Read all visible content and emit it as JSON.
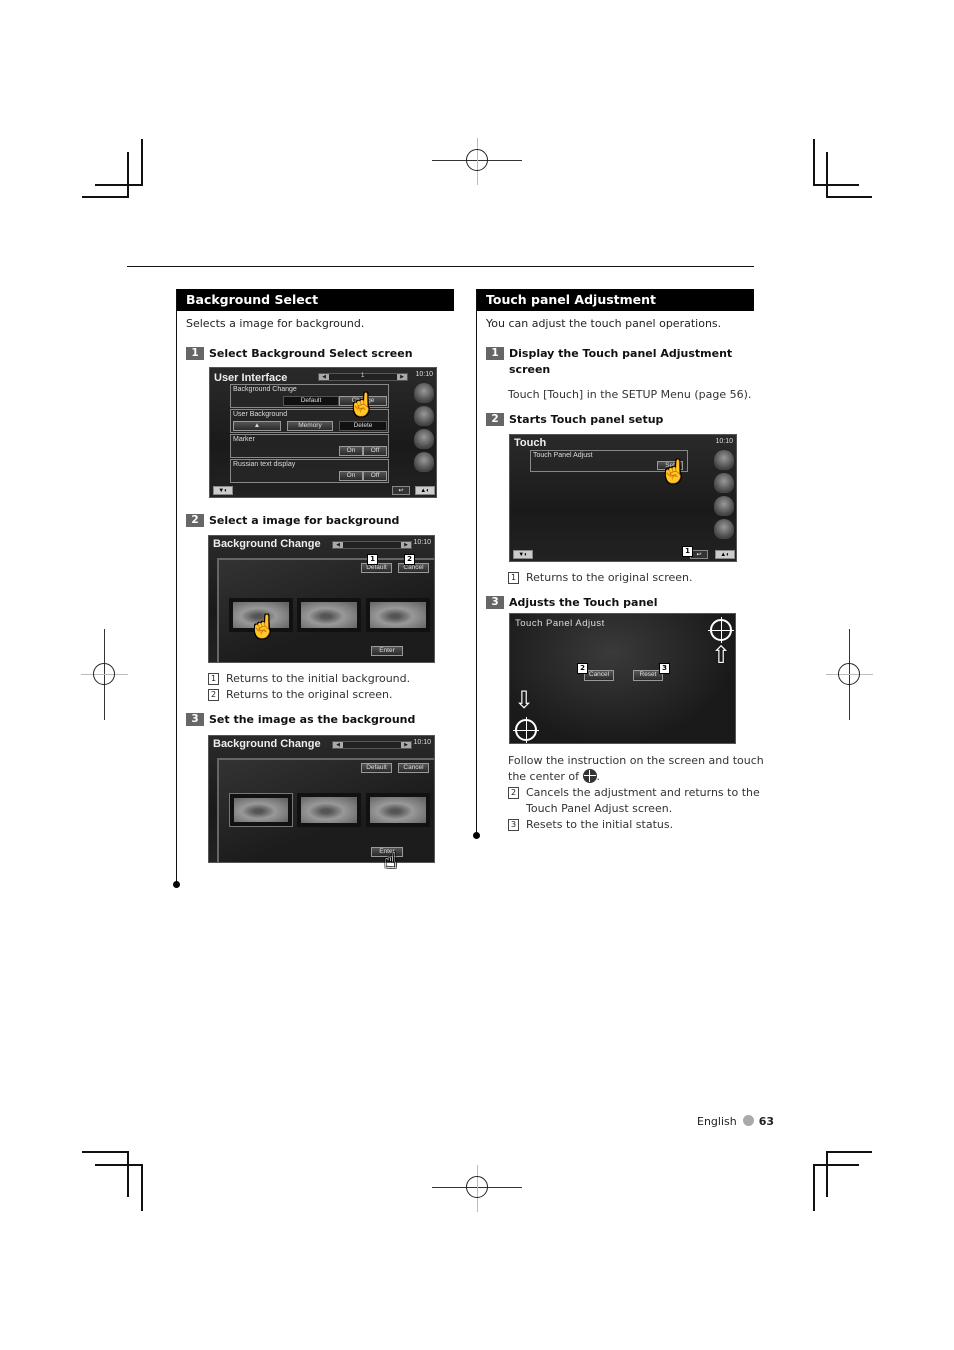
{
  "page": {
    "language": "English",
    "page_number": "63"
  },
  "left": {
    "title": "Background Select",
    "intro": "Selects a image for background.",
    "steps": [
      {
        "num": "1",
        "label": "Select Background Select screen"
      },
      {
        "num": "2",
        "label": "Select a image for background"
      },
      {
        "num": "3",
        "label": "Set the image as the background"
      }
    ],
    "notes_step2": [
      {
        "num": "1",
        "text": "Returns to the initial background."
      },
      {
        "num": "2",
        "text": "Returns to the original screen."
      }
    ],
    "screen1": {
      "title": "User Interface",
      "time": "10:10",
      "page_indicator": "1",
      "rows": [
        {
          "label": "Background Change",
          "buttons": [
            "Default",
            "Change"
          ]
        },
        {
          "label": "User Background",
          "buttons": [
            "▲",
            "Memory",
            "Delete"
          ]
        },
        {
          "label": "Marker",
          "buttons": [
            "On",
            "Off"
          ]
        },
        {
          "label": "Russian text display",
          "buttons": [
            "On",
            "Off"
          ]
        }
      ]
    },
    "screen2": {
      "title": "Background Change",
      "time": "10:10",
      "buttons": [
        "Default",
        "Cancel",
        "Enter"
      ],
      "callouts": [
        "1",
        "2"
      ]
    },
    "screen3": {
      "title": "Background Change",
      "time": "10:10",
      "buttons": [
        "Default",
        "Cancel",
        "Enter"
      ]
    }
  },
  "right": {
    "title": "Touch panel Adjustment",
    "intro": "You can adjust the touch panel operations.",
    "steps": [
      {
        "num": "1",
        "label": "Display the Touch panel Adjustment screen"
      },
      {
        "num": "2",
        "label": "Starts Touch panel setup"
      },
      {
        "num": "3",
        "label": "Adjusts the Touch panel"
      }
    ],
    "step1_text": "Touch [Touch] in the SETUP Menu (page 56).",
    "notes_step2": [
      {
        "num": "1",
        "text": "Returns to the original screen."
      }
    ],
    "step3_text_a": "Follow the instruction on the screen and touch",
    "step3_text_b": "the center of",
    "notes_step3": [
      {
        "num": "2",
        "text": "Cancels the adjustment and returns to the",
        "text2": "Touch Panel Adjust screen."
      },
      {
        "num": "3",
        "text": "Resets to the initial status."
      }
    ],
    "screen1": {
      "title": "Touch",
      "time": "10:10",
      "row_label": "Touch Panel Adjust",
      "button": "Set",
      "callout": "1"
    },
    "screen2": {
      "title": "Touch Panel Adjust",
      "buttons": [
        "Cancel",
        "Reset"
      ],
      "callouts": [
        "2",
        "3"
      ]
    }
  }
}
